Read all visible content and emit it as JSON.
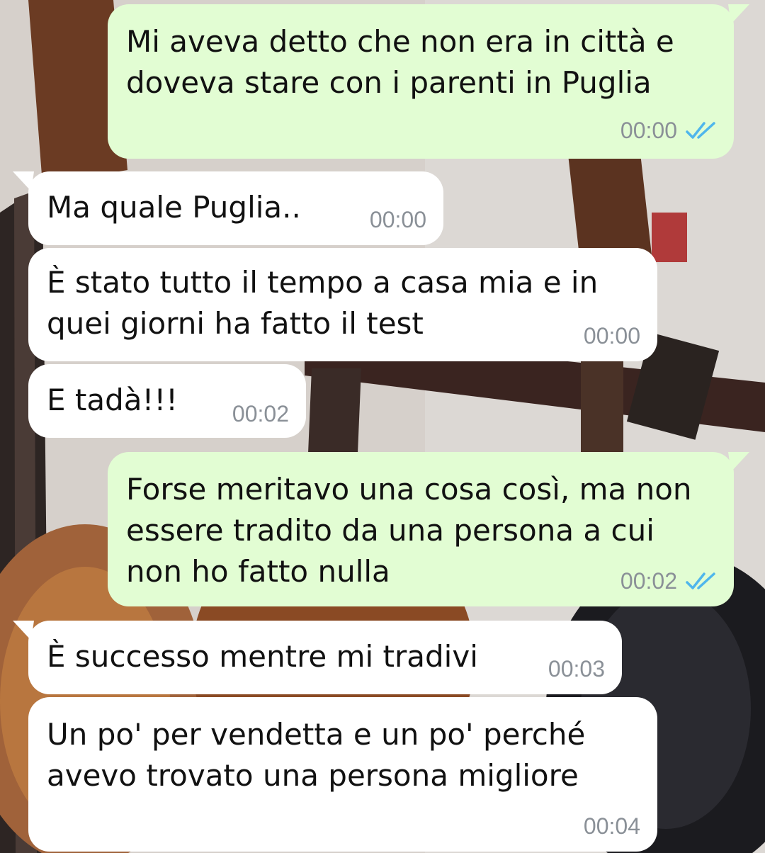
{
  "conversation": {
    "messages": [
      {
        "direction": "out",
        "text": "Mi aveva detto che non era in città e\ndoveva stare con i parenti in Puglia",
        "time": "00:00",
        "status": "read"
      },
      {
        "direction": "in",
        "text": "Ma quale Puglia..",
        "time": "00:00"
      },
      {
        "direction": "in",
        "text": "È stato tutto il tempo a casa mia e in\nquei giorni ha fatto il test",
        "time": "00:00"
      },
      {
        "direction": "in",
        "text": "E tadà!!!",
        "time": "00:02"
      },
      {
        "direction": "out",
        "text": "Forse meritavo una cosa così, ma non\nessere tradito da una persona a cui\nnon ho fatto nulla",
        "time": "00:02",
        "status": "read"
      },
      {
        "direction": "in",
        "text": "È successo mentre mi tradivi",
        "time": "00:03"
      },
      {
        "direction": "in",
        "text": "Un po' per vendetta e un po' perché\navevo trovato una persona migliore",
        "time": "00:04"
      }
    ]
  },
  "colors": {
    "outgoing_bubble": "#e2fdd3",
    "incoming_bubble": "#ffffff",
    "timestamp": "#8a9097",
    "read_ticks": "#4fb6ec"
  },
  "icons": {
    "read_receipt": "double-check-icon"
  }
}
